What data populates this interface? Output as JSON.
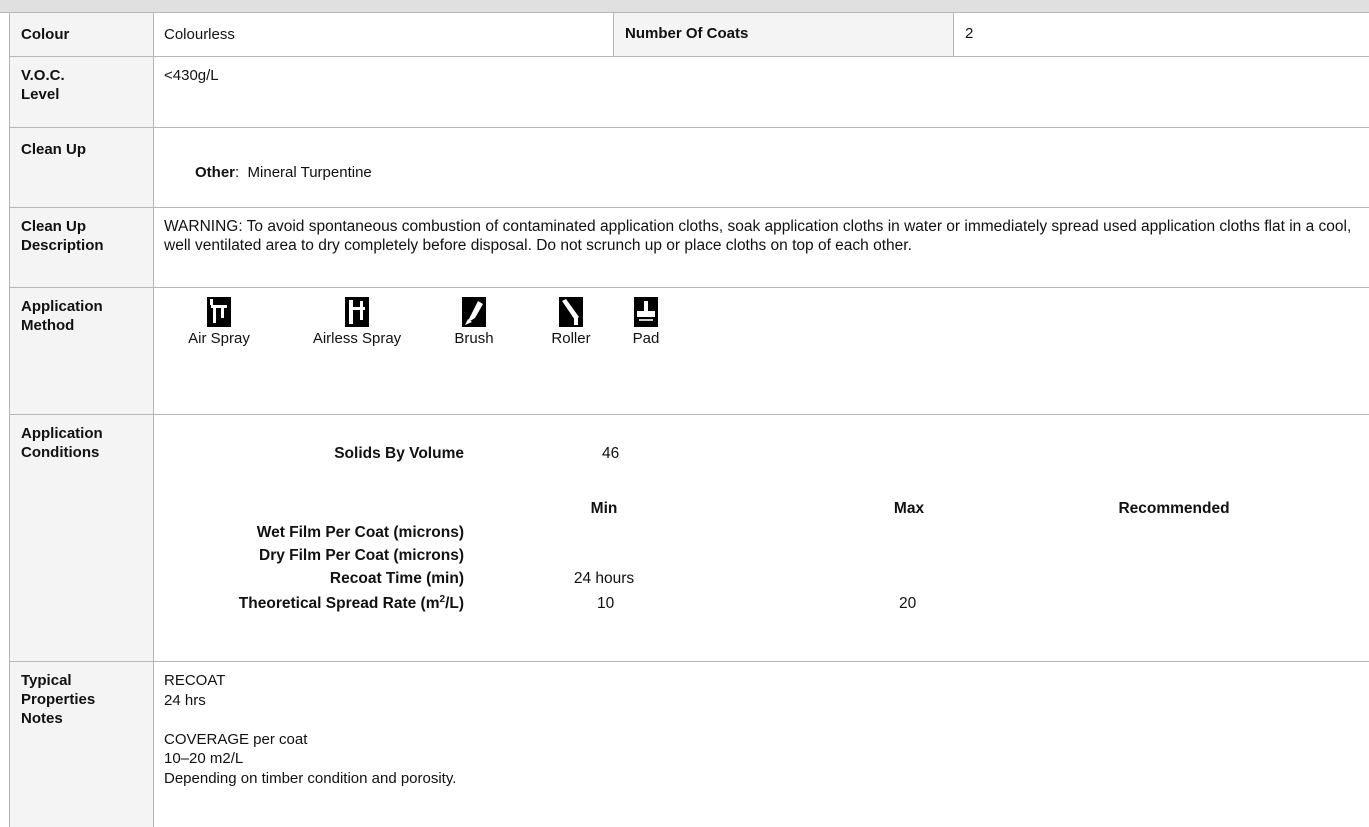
{
  "colour": {
    "label": "Colour",
    "value": "Colourless"
  },
  "coats": {
    "label": "Number Of Coats",
    "value": "2"
  },
  "voc": {
    "label": "V.O.C. Level",
    "value": "<430g/L"
  },
  "cleanup": {
    "label": "Clean Up",
    "key": "Other",
    "value": "Mineral Turpentine"
  },
  "cleanup_desc": {
    "label": "Clean Up Description",
    "text": "WARNING: To avoid spontaneous combustion of contaminated application cloths, soak application cloths in water or immediately spread used application cloths flat in a cool, well ventilated area to dry completely before disposal. Do not scrunch up or place cloths on top of each other."
  },
  "method": {
    "label": "Application Method",
    "items": [
      {
        "label": "Air Spray",
        "icon": "air-spray-icon"
      },
      {
        "label": "Airless Spray",
        "icon": "airless-spray-icon"
      },
      {
        "label": "Brush",
        "icon": "brush-icon"
      },
      {
        "label": "Roller",
        "icon": "roller-icon"
      },
      {
        "label": "Pad",
        "icon": "pad-icon"
      }
    ]
  },
  "conditions": {
    "label": "Application Conditions",
    "solids_label": "Solids By Volume",
    "solids_value": "46",
    "col_min": "Min",
    "col_max": "Max",
    "col_rec": "Recommended",
    "rows": [
      {
        "label": "Wet Film Per Coat (microns)",
        "min": "",
        "max": "",
        "rec": ""
      },
      {
        "label": "Dry Film Per Coat (microns)",
        "min": "",
        "max": "",
        "rec": ""
      },
      {
        "label": "Recoat Time (min)",
        "min": "24 hours",
        "max": "",
        "rec": ""
      }
    ],
    "spread_label_pre": "Theoretical Spread Rate (m",
    "spread_label_sup": "2",
    "spread_label_post": "/L)",
    "spread_min": "10",
    "spread_max": "20",
    "spread_rec": ""
  },
  "notes": {
    "label": "Typical Properties Notes",
    "lines": [
      "RECOAT",
      "24 hrs",
      "",
      "COVERAGE per coat",
      "10–20 m2/L",
      "Depending on timber condition and porosity."
    ]
  }
}
